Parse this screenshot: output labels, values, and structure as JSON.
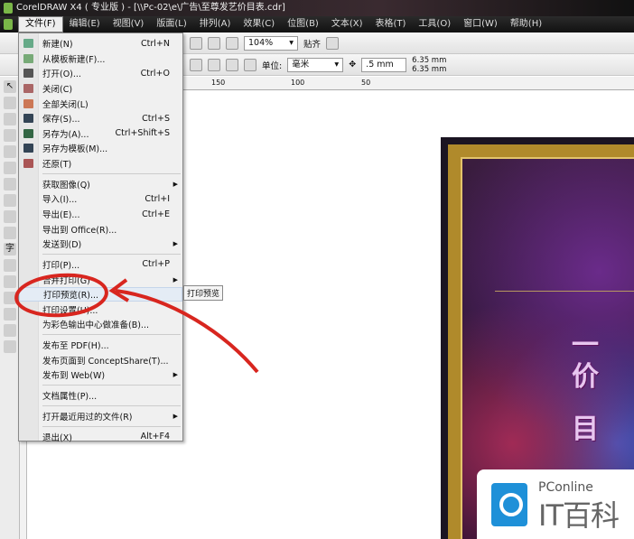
{
  "title": "CorelDRAW X4 ( 专业版 ) - [\\\\Pc-02\\e\\广告\\至尊发艺价目表.cdr]",
  "menubar": [
    "文件(F)",
    "编辑(E)",
    "视图(V)",
    "版面(L)",
    "排列(A)",
    "效果(C)",
    "位图(B)",
    "文本(X)",
    "表格(T)",
    "工具(O)",
    "窗口(W)",
    "帮助(H)"
  ],
  "toolbar": {
    "zoom": "104%",
    "snap": "贴齐",
    "unit_label": "单位:",
    "unit": "毫米",
    "nudge": ".5 mm",
    "dup_x": "6.35 mm",
    "dup_y": "6.35 mm"
  },
  "ruler": [
    "150",
    "100",
    "50"
  ],
  "file_menu": [
    {
      "label": "新建(N)",
      "shortcut": "Ctrl+N"
    },
    {
      "label": "从模板新建(F)...",
      "shortcut": ""
    },
    {
      "label": "打开(O)...",
      "shortcut": "Ctrl+O"
    },
    {
      "label": "关闭(C)",
      "shortcut": ""
    },
    {
      "label": "全部关闭(L)",
      "shortcut": ""
    },
    {
      "label": "保存(S)...",
      "shortcut": "Ctrl+S"
    },
    {
      "label": "另存为(A)...",
      "shortcut": "Ctrl+Shift+S"
    },
    {
      "label": "另存为模板(M)...",
      "shortcut": ""
    },
    {
      "label": "还原(T)",
      "shortcut": ""
    },
    {
      "sep": true
    },
    {
      "label": "获取图像(Q)",
      "shortcut": "",
      "sub": true
    },
    {
      "label": "导入(I)...",
      "shortcut": "Ctrl+I"
    },
    {
      "label": "导出(E)...",
      "shortcut": "Ctrl+E"
    },
    {
      "label": "导出到 Office(R)...",
      "shortcut": ""
    },
    {
      "label": "发送到(D)",
      "shortcut": "",
      "sub": true
    },
    {
      "sep": true
    },
    {
      "label": "打印(P)...",
      "shortcut": "Ctrl+P"
    },
    {
      "label": "合并打印(G)",
      "shortcut": "",
      "sub": true
    },
    {
      "label": "打印预览(R)...",
      "shortcut": "",
      "highlight": true
    },
    {
      "label": "打印设置(U)...",
      "shortcut": ""
    },
    {
      "label": "为彩色输出中心做准备(B)...",
      "shortcut": ""
    },
    {
      "sep": true
    },
    {
      "label": "发布至 PDF(H)...",
      "shortcut": ""
    },
    {
      "label": "发布页面到 ConceptShare(T)...",
      "shortcut": ""
    },
    {
      "label": "发布到 Web(W)",
      "shortcut": "",
      "sub": true
    },
    {
      "sep": true
    },
    {
      "label": "文档属性(P)...",
      "shortcut": ""
    },
    {
      "sep": true
    },
    {
      "label": "打开最近用过的文件(R)",
      "shortcut": "",
      "sub": true
    },
    {
      "sep": true
    },
    {
      "label": "退出(X)",
      "shortcut": "Alt+F4"
    }
  ],
  "tooltip": "打印预览",
  "poster_chars": [
    "一",
    "价",
    "目"
  ],
  "watermark": {
    "line1": "PConline",
    "line2": "IT百科"
  },
  "colors": {
    "annotation": "#d8261f",
    "menu_bg": "#f0f0f0"
  }
}
